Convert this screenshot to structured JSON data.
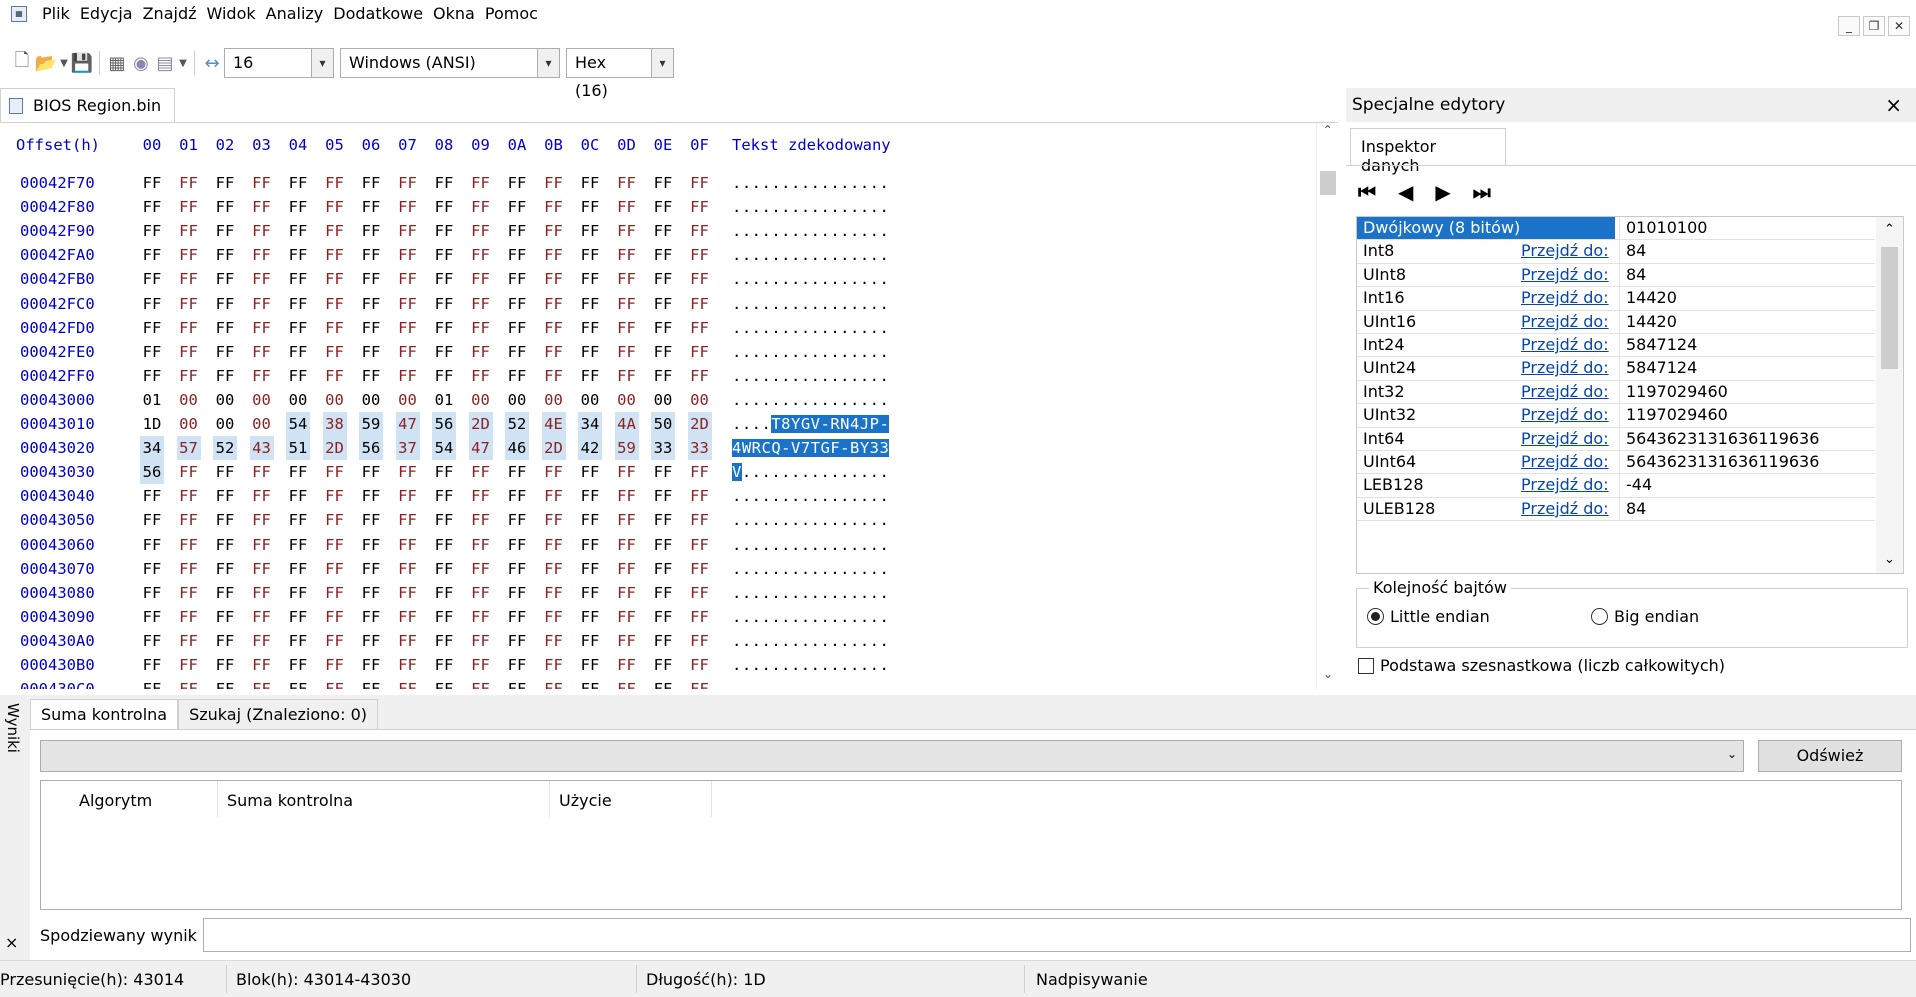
{
  "menu": [
    "Plik",
    "Edycja",
    "Znajdź",
    "Widok",
    "Analizy",
    "Dodatkowe",
    "Okna",
    "Pomoc"
  ],
  "toolbar": {
    "bytes_per_row": "16",
    "encoding": "Windows (ANSI)",
    "offset_base": "Hex (16)"
  },
  "document_tab": "BIOS Region.bin",
  "hex": {
    "header_offset": "Offset(h)",
    "header_cols": [
      "00",
      "01",
      "02",
      "03",
      "04",
      "05",
      "06",
      "07",
      "08",
      "09",
      "0A",
      "0B",
      "0C",
      "0D",
      "0E",
      "0F"
    ],
    "header_text": "Tekst zdekodowany",
    "rows": [
      {
        "off": "00042F70",
        "bytes": [
          "FF",
          "FF",
          "FF",
          "FF",
          "FF",
          "FF",
          "FF",
          "FF",
          "FF",
          "FF",
          "FF",
          "FF",
          "FF",
          "FF",
          "FF",
          "FF"
        ],
        "text": "................"
      },
      {
        "off": "00042F80",
        "bytes": [
          "FF",
          "FF",
          "FF",
          "FF",
          "FF",
          "FF",
          "FF",
          "FF",
          "FF",
          "FF",
          "FF",
          "FF",
          "FF",
          "FF",
          "FF",
          "FF"
        ],
        "text": "................"
      },
      {
        "off": "00042F90",
        "bytes": [
          "FF",
          "FF",
          "FF",
          "FF",
          "FF",
          "FF",
          "FF",
          "FF",
          "FF",
          "FF",
          "FF",
          "FF",
          "FF",
          "FF",
          "FF",
          "FF"
        ],
        "text": "................"
      },
      {
        "off": "00042FA0",
        "bytes": [
          "FF",
          "FF",
          "FF",
          "FF",
          "FF",
          "FF",
          "FF",
          "FF",
          "FF",
          "FF",
          "FF",
          "FF",
          "FF",
          "FF",
          "FF",
          "FF"
        ],
        "text": "................"
      },
      {
        "off": "00042FB0",
        "bytes": [
          "FF",
          "FF",
          "FF",
          "FF",
          "FF",
          "FF",
          "FF",
          "FF",
          "FF",
          "FF",
          "FF",
          "FF",
          "FF",
          "FF",
          "FF",
          "FF"
        ],
        "text": "................"
      },
      {
        "off": "00042FC0",
        "bytes": [
          "FF",
          "FF",
          "FF",
          "FF",
          "FF",
          "FF",
          "FF",
          "FF",
          "FF",
          "FF",
          "FF",
          "FF",
          "FF",
          "FF",
          "FF",
          "FF"
        ],
        "text": "................"
      },
      {
        "off": "00042FD0",
        "bytes": [
          "FF",
          "FF",
          "FF",
          "FF",
          "FF",
          "FF",
          "FF",
          "FF",
          "FF",
          "FF",
          "FF",
          "FF",
          "FF",
          "FF",
          "FF",
          "FF"
        ],
        "text": "................"
      },
      {
        "off": "00042FE0",
        "bytes": [
          "FF",
          "FF",
          "FF",
          "FF",
          "FF",
          "FF",
          "FF",
          "FF",
          "FF",
          "FF",
          "FF",
          "FF",
          "FF",
          "FF",
          "FF",
          "FF"
        ],
        "text": "................"
      },
      {
        "off": "00042FF0",
        "bytes": [
          "FF",
          "FF",
          "FF",
          "FF",
          "FF",
          "FF",
          "FF",
          "FF",
          "FF",
          "FF",
          "FF",
          "FF",
          "FF",
          "FF",
          "FF",
          "FF"
        ],
        "text": "................"
      },
      {
        "off": "00043000",
        "bytes": [
          "01",
          "00",
          "00",
          "00",
          "00",
          "00",
          "00",
          "00",
          "01",
          "00",
          "00",
          "00",
          "00",
          "00",
          "00",
          "00"
        ],
        "text": "................"
      },
      {
        "off": "00043010",
        "bytes": [
          "1D",
          "00",
          "00",
          "00",
          "54",
          "38",
          "59",
          "47",
          "56",
          "2D",
          "52",
          "4E",
          "34",
          "4A",
          "50",
          "2D"
        ],
        "text_pre": "....",
        "text": "T8YGV-RN4JP-",
        "sel_from": 4
      },
      {
        "off": "00043020",
        "bytes": [
          "34",
          "57",
          "52",
          "43",
          "51",
          "2D",
          "56",
          "37",
          "54",
          "47",
          "46",
          "2D",
          "42",
          "59",
          "33",
          "33"
        ],
        "text_pre": "",
        "text": "4WRCQ-V7TGF-BY33",
        "sel_from": 0
      },
      {
        "off": "00043030",
        "bytes": [
          "56",
          "FF",
          "FF",
          "FF",
          "FF",
          "FF",
          "FF",
          "FF",
          "FF",
          "FF",
          "FF",
          "FF",
          "FF",
          "FF",
          "FF",
          "FF"
        ],
        "text_pre": "",
        "text": "V",
        "text_post": "...............",
        "sel_from": 0,
        "sel_to": 0
      },
      {
        "off": "00043040",
        "bytes": [
          "FF",
          "FF",
          "FF",
          "FF",
          "FF",
          "FF",
          "FF",
          "FF",
          "FF",
          "FF",
          "FF",
          "FF",
          "FF",
          "FF",
          "FF",
          "FF"
        ],
        "text": "................"
      },
      {
        "off": "00043050",
        "bytes": [
          "FF",
          "FF",
          "FF",
          "FF",
          "FF",
          "FF",
          "FF",
          "FF",
          "FF",
          "FF",
          "FF",
          "FF",
          "FF",
          "FF",
          "FF",
          "FF"
        ],
        "text": "................"
      },
      {
        "off": "00043060",
        "bytes": [
          "FF",
          "FF",
          "FF",
          "FF",
          "FF",
          "FF",
          "FF",
          "FF",
          "FF",
          "FF",
          "FF",
          "FF",
          "FF",
          "FF",
          "FF",
          "FF"
        ],
        "text": "................"
      },
      {
        "off": "00043070",
        "bytes": [
          "FF",
          "FF",
          "FF",
          "FF",
          "FF",
          "FF",
          "FF",
          "FF",
          "FF",
          "FF",
          "FF",
          "FF",
          "FF",
          "FF",
          "FF",
          "FF"
        ],
        "text": "................"
      },
      {
        "off": "00043080",
        "bytes": [
          "FF",
          "FF",
          "FF",
          "FF",
          "FF",
          "FF",
          "FF",
          "FF",
          "FF",
          "FF",
          "FF",
          "FF",
          "FF",
          "FF",
          "FF",
          "FF"
        ],
        "text": "................"
      },
      {
        "off": "00043090",
        "bytes": [
          "FF",
          "FF",
          "FF",
          "FF",
          "FF",
          "FF",
          "FF",
          "FF",
          "FF",
          "FF",
          "FF",
          "FF",
          "FF",
          "FF",
          "FF",
          "FF"
        ],
        "text": "................"
      },
      {
        "off": "000430A0",
        "bytes": [
          "FF",
          "FF",
          "FF",
          "FF",
          "FF",
          "FF",
          "FF",
          "FF",
          "FF",
          "FF",
          "FF",
          "FF",
          "FF",
          "FF",
          "FF",
          "FF"
        ],
        "text": "................"
      },
      {
        "off": "000430B0",
        "bytes": [
          "FF",
          "FF",
          "FF",
          "FF",
          "FF",
          "FF",
          "FF",
          "FF",
          "FF",
          "FF",
          "FF",
          "FF",
          "FF",
          "FF",
          "FF",
          "FF"
        ],
        "text": "................"
      },
      {
        "off": "000430C0",
        "bytes": [
          "FF",
          "FF",
          "FF",
          "FF",
          "FF",
          "FF",
          "FF",
          "FF",
          "FF",
          "FF",
          "FF",
          "FF",
          "FF",
          "FF",
          "FF",
          "FF"
        ],
        "text": "................"
      }
    ]
  },
  "inspector": {
    "panel_title": "Specjalne edytory",
    "tab": "Inspektor danych",
    "goto_label": "Przejdź do:",
    "rows": [
      {
        "name": "Dwójkowy (8 bitów)",
        "value": "01010100"
      },
      {
        "name": "Int8",
        "value": "84"
      },
      {
        "name": "UInt8",
        "value": "84"
      },
      {
        "name": "Int16",
        "value": "14420"
      },
      {
        "name": "UInt16",
        "value": "14420"
      },
      {
        "name": "Int24",
        "value": "5847124"
      },
      {
        "name": "UInt24",
        "value": "5847124"
      },
      {
        "name": "Int32",
        "value": "1197029460"
      },
      {
        "name": "UInt32",
        "value": "1197029460"
      },
      {
        "name": "Int64",
        "value": "5643623131636119636"
      },
      {
        "name": "UInt64",
        "value": "5643623131636119636"
      },
      {
        "name": "LEB128",
        "value": "-44"
      },
      {
        "name": "ULEB128",
        "value": "84"
      }
    ],
    "byte_order_label": "Kolejność bajtów",
    "little_endian": "Little endian",
    "big_endian": "Big endian",
    "hex_base": "Podstawa szesnastkowa (liczb całkowitych)"
  },
  "results": {
    "side_label": "Wyniki",
    "tabs": [
      "Suma kontrolna",
      "Szukaj (Znaleziono: 0)"
    ],
    "refresh": "Odśwież",
    "cols": [
      "Algorytm",
      "Suma kontrolna",
      "Użycie"
    ],
    "expected": "Spodziewany wynik"
  },
  "status": {
    "offset": "Przesunięcie(h): 43014",
    "block": "Blok(h): 43014-43030",
    "length": "Długość(h): 1D",
    "mode": "Nadpisywanie"
  }
}
